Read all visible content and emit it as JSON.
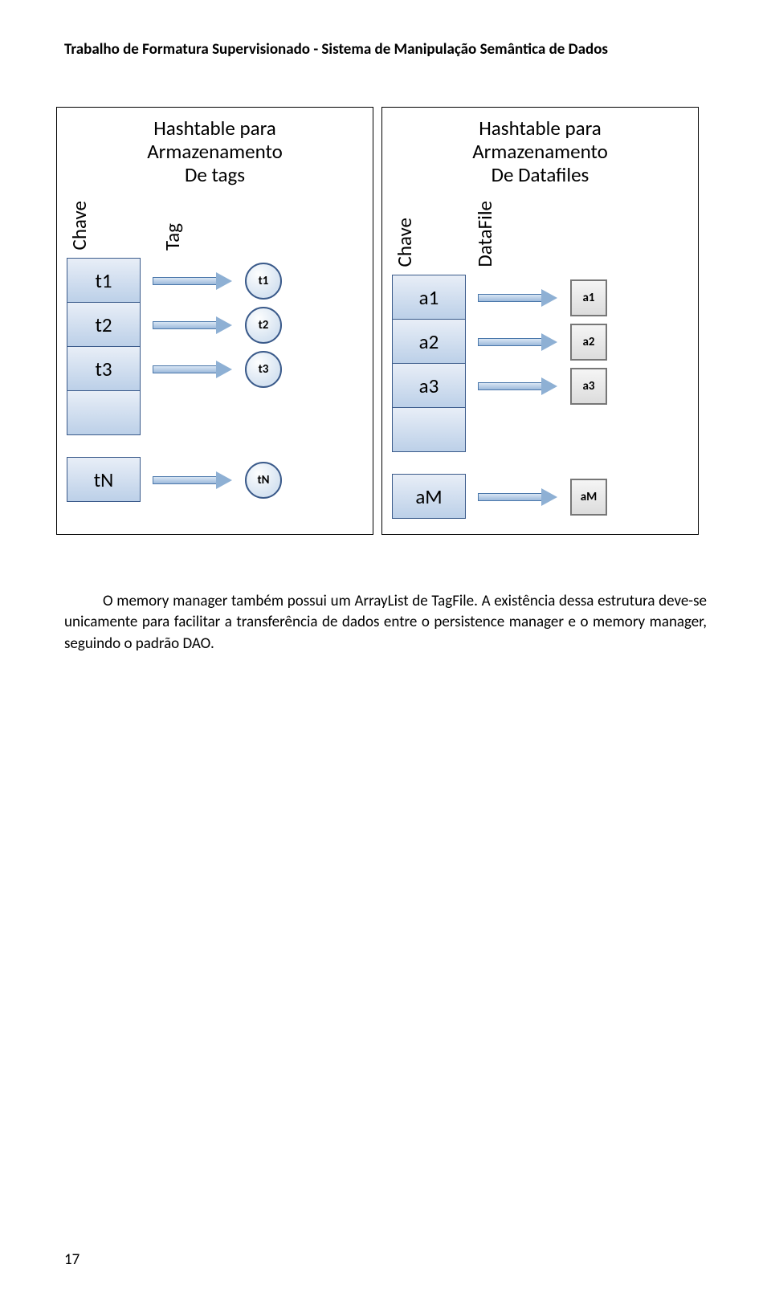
{
  "header": "Trabalho de Formatura Supervisionado - Sistema de Manipulação Semântica de Dados",
  "diagram": {
    "left": {
      "title_l1": "Hashtable para",
      "title_l2": "Armazenamento",
      "title_l3": "De tags",
      "label_chave": "Chave",
      "label_value": "Tag",
      "keys": [
        "t1",
        "t2",
        "t3"
      ],
      "last_key": "tN",
      "nodes": [
        "t1",
        "t2",
        "t3"
      ],
      "last_node": "tN"
    },
    "right": {
      "title_l1": "Hashtable para",
      "title_l2": "Armazenamento",
      "title_l3": "De Datafiles",
      "label_chave": "Chave",
      "label_value": "DataFile",
      "keys": [
        "a1",
        "a2",
        "a3"
      ],
      "last_key": "aM",
      "nodes": [
        "a1",
        "a2",
        "a3"
      ],
      "last_node": "aM"
    }
  },
  "paragraph": "O memory manager também possui um ArrayList de TagFile. A existência dessa estrutura deve-se unicamente para facilitar a transferência de dados entre o persistence manager e o memory manager, seguindo o padrão DAO.",
  "page_number": "17"
}
